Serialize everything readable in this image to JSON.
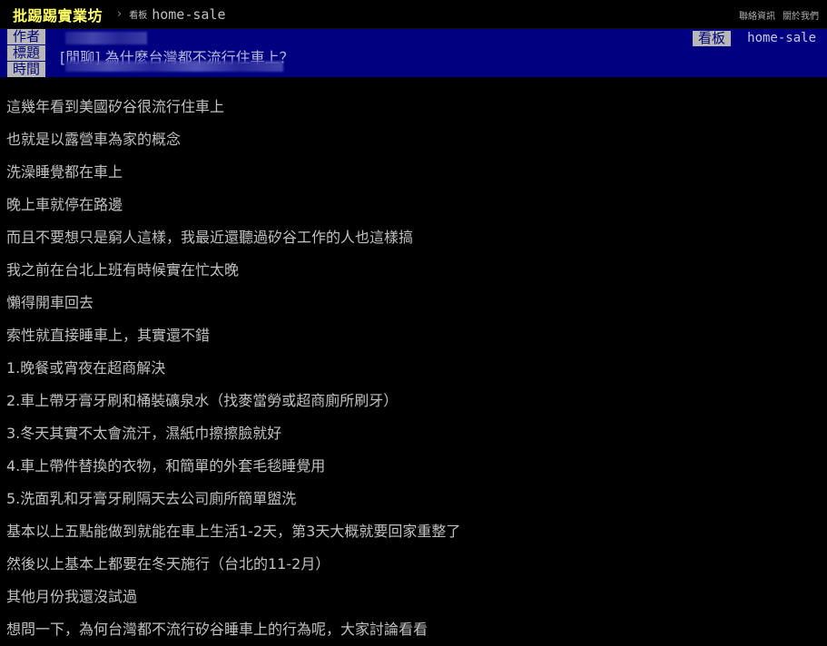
{
  "topbar": {
    "site_title": "批踢踢實業坊",
    "separator": "›",
    "board_tag": "看板",
    "board_name": "home-sale",
    "links": [
      "聯絡資訊",
      "關於我們"
    ]
  },
  "header": {
    "labels": [
      "作者",
      "標題",
      "時間"
    ],
    "title": "[閒聊] 為什麼台灣都不流行住車上？",
    "board_label": "看板",
    "board_value": "home-sale",
    "colors": {
      "header_bg": "#000080",
      "tag_bg": "#b7b7b7",
      "site_title": "#ffff66"
    }
  },
  "post": {
    "lines": [
      "這幾年看到美國矽谷很流行住車上",
      "也就是以露營車為家的概念",
      "洗澡睡覺都在車上",
      "晚上車就停在路邊",
      "而且不要想只是窮人這樣，我最近還聽過矽谷工作的人也這樣搞",
      "我之前在台北上班有時候實在忙太晚",
      "懶得開車回去",
      "索性就直接睡車上，其實還不錯",
      "1.晚餐或宵夜在超商解決",
      "2.車上帶牙膏牙刷和桶裝礦泉水（找麥當勞或超商廁所刷牙）",
      "3.冬天其實不太會流汗，濕紙巾擦擦臉就好",
      "4.車上帶件替換的衣物，和簡單的外套毛毯睡覺用",
      "5.洗面乳和牙膏牙刷隔天去公司廁所簡單盥洗",
      "基本以上五點能做到就能在車上生活1-2天，第3天大概就要回家重整了",
      "然後以上基本上都要在冬天施行（台北的11-2月）",
      "其他月份我還沒試過",
      "想問一下，為何台灣都不流行矽谷睡車上的行為呢，大家討論看看"
    ]
  }
}
